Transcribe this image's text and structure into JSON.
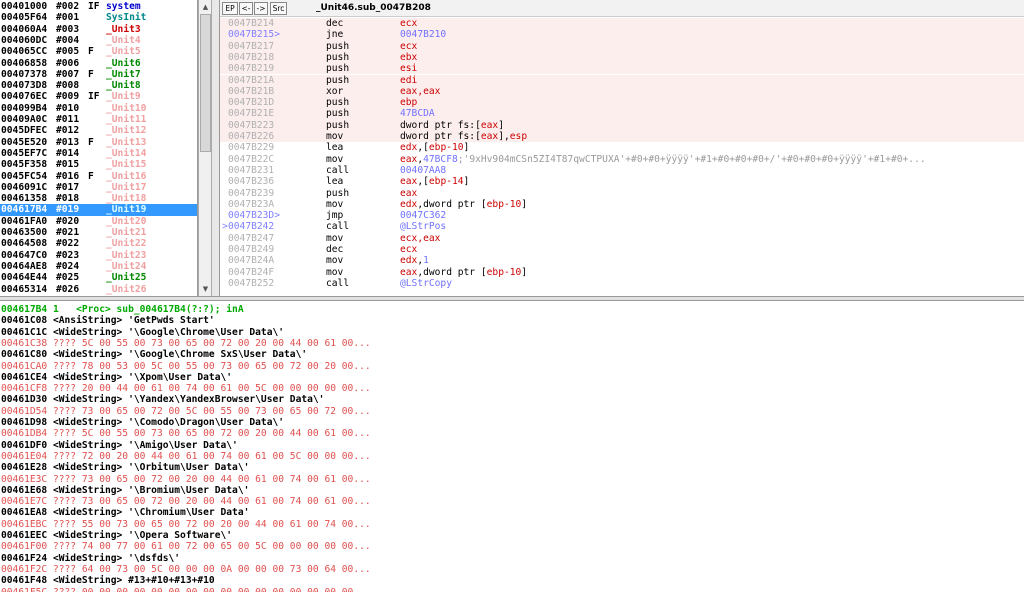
{
  "units": [
    {
      "addr": "00401000",
      "num": "#002",
      "flag": "IF",
      "name": "system",
      "color": "#0000cc"
    },
    {
      "addr": "00405F64",
      "num": "#001",
      "flag": "",
      "name": "SysInit",
      "color": "#008888"
    },
    {
      "addr": "004060A4",
      "num": "#003",
      "flag": "",
      "name": "_Unit3",
      "color": "#cc0000"
    },
    {
      "addr": "004060DC",
      "num": "#004",
      "flag": "",
      "name": "_Unit4",
      "color": "#f0a0a0"
    },
    {
      "addr": "004065CC",
      "num": "#005",
      "flag": "F",
      "name": "_Unit5",
      "color": "#f0a0a0"
    },
    {
      "addr": "00406858",
      "num": "#006",
      "flag": "",
      "name": "_Unit6",
      "color": "#008800"
    },
    {
      "addr": "00407378",
      "num": "#007",
      "flag": "F",
      "name": "_Unit7",
      "color": "#008800"
    },
    {
      "addr": "004073D8",
      "num": "#008",
      "flag": "",
      "name": "_Unit8",
      "color": "#008800"
    },
    {
      "addr": "004076EC",
      "num": "#009",
      "flag": "IF",
      "name": "_Unit9",
      "color": "#f0a0a0"
    },
    {
      "addr": "004099B4",
      "num": "#010",
      "flag": "",
      "name": "_Unit10",
      "color": "#f0a0a0"
    },
    {
      "addr": "00409A0C",
      "num": "#011",
      "flag": "",
      "name": "_Unit11",
      "color": "#f0a0a0"
    },
    {
      "addr": "0045DFEC",
      "num": "#012",
      "flag": "",
      "name": "_Unit12",
      "color": "#f0a0a0"
    },
    {
      "addr": "0045E520",
      "num": "#013",
      "flag": "F",
      "name": "_Unit13",
      "color": "#f0a0a0"
    },
    {
      "addr": "0045EF7C",
      "num": "#014",
      "flag": "",
      "name": "_Unit14",
      "color": "#f0a0a0"
    },
    {
      "addr": "0045F358",
      "num": "#015",
      "flag": "",
      "name": "_Unit15",
      "color": "#f0a0a0"
    },
    {
      "addr": "0045FC54",
      "num": "#016",
      "flag": "F",
      "name": "_Unit16",
      "color": "#f0a0a0"
    },
    {
      "addr": "0046091C",
      "num": "#017",
      "flag": "",
      "name": "_Unit17",
      "color": "#f0a0a0"
    },
    {
      "addr": "00461358",
      "num": "#018",
      "flag": "",
      "name": "_Unit18",
      "color": "#f0a0a0"
    },
    {
      "addr": "004617B4",
      "num": "#019",
      "flag": "",
      "name": "_Unit19",
      "color": "#f0a0a0",
      "selected": true
    },
    {
      "addr": "00461FA0",
      "num": "#020",
      "flag": "",
      "name": "_Unit20",
      "color": "#f0a0a0"
    },
    {
      "addr": "00463500",
      "num": "#021",
      "flag": "",
      "name": "_Unit21",
      "color": "#f0a0a0"
    },
    {
      "addr": "00464508",
      "num": "#022",
      "flag": "",
      "name": "_Unit22",
      "color": "#f0a0a0"
    },
    {
      "addr": "004647C0",
      "num": "#023",
      "flag": "",
      "name": "_Unit23",
      "color": "#f0a0a0"
    },
    {
      "addr": "00464AE8",
      "num": "#024",
      "flag": "",
      "name": "_Unit24",
      "color": "#f0a0a0"
    },
    {
      "addr": "00464E44",
      "num": "#025",
      "flag": "",
      "name": "_Unit25",
      "color": "#008800"
    },
    {
      "addr": "00465314",
      "num": "#026",
      "flag": "",
      "name": "_Unit26",
      "color": "#f0a0a0"
    }
  ],
  "toolbar": {
    "ep_label": "EP",
    "back_label": "<-",
    "fwd_label": "->",
    "src_label": "Src",
    "proc_title": "_Unit46.sub_0047B208"
  },
  "code_lines": [
    {
      "arrow": "",
      "addr": "0047B214",
      "mn": "dec",
      "op": [
        {
          "t": "ecx",
          "c": "red"
        }
      ],
      "shade": true
    },
    {
      "arrow": "",
      "addr": "0047B215>",
      "mn": "jne",
      "op": [
        {
          "t": "0047B210",
          "c": "blu"
        }
      ],
      "shade": true,
      "jt": true
    },
    {
      "arrow": "",
      "addr": "0047B217",
      "mn": "push",
      "op": [
        {
          "t": "ecx",
          "c": "red"
        }
      ],
      "shade": true
    },
    {
      "arrow": "",
      "addr": "0047B218",
      "mn": "push",
      "op": [
        {
          "t": "ebx",
          "c": "red"
        }
      ],
      "shade": true
    },
    {
      "arrow": "",
      "addr": "0047B219",
      "mn": "push",
      "op": [
        {
          "t": "esi",
          "c": "red"
        }
      ],
      "shade": true
    },
    {
      "arrow": "",
      "addr": "0047B21A",
      "mn": "push",
      "op": [
        {
          "t": "edi",
          "c": "red"
        }
      ],
      "shade": true
    },
    {
      "arrow": "",
      "addr": "0047B21B",
      "mn": "xor",
      "op": [
        {
          "t": "eax,eax",
          "c": "red"
        }
      ],
      "shade": true
    },
    {
      "arrow": "",
      "addr": "0047B21D",
      "mn": "push",
      "op": [
        {
          "t": "ebp",
          "c": "red"
        }
      ],
      "shade": true
    },
    {
      "arrow": "",
      "addr": "0047B21E",
      "mn": "push",
      "op": [
        {
          "t": "47BCDA",
          "c": "blu"
        }
      ],
      "shade": true
    },
    {
      "arrow": "",
      "addr": "0047B223",
      "mn": "push",
      "op": [
        {
          "t": "dword ptr fs:[",
          "c": ""
        },
        {
          "t": "eax",
          "c": "red"
        },
        {
          "t": "]",
          "c": ""
        }
      ],
      "shade": true
    },
    {
      "arrow": "",
      "addr": "0047B226",
      "mn": "mov",
      "op": [
        {
          "t": "dword ptr fs:[",
          "c": ""
        },
        {
          "t": "eax",
          "c": "red"
        },
        {
          "t": "],",
          "c": ""
        },
        {
          "t": "esp",
          "c": "red"
        }
      ],
      "shade": true
    },
    {
      "arrow": "",
      "addr": "0047B229",
      "mn": "lea",
      "op": [
        {
          "t": "edx",
          "c": "red"
        },
        {
          "t": ",[",
          "c": ""
        },
        {
          "t": "ebp-10",
          "c": "red"
        },
        {
          "t": "]",
          "c": ""
        }
      ],
      "shade": false
    },
    {
      "arrow": "",
      "addr": "0047B22C",
      "mn": "mov",
      "op": [
        {
          "t": "eax",
          "c": "red"
        },
        {
          "t": ",",
          "c": ""
        },
        {
          "t": "47BCF8",
          "c": "blu"
        },
        {
          "t": ";'9xHv904mCSn5ZI4T87qwCTPUXA'+#0+#0+ÿÿÿÿ'+#1+#0+#0+#0+/'+#0+#0+#0+ÿÿÿÿ'+#1+#0+...",
          "c": "gry"
        }
      ],
      "shade": false
    },
    {
      "arrow": "",
      "addr": "0047B231",
      "mn": "call",
      "op": [
        {
          "t": "00407AA8",
          "c": "blu"
        }
      ],
      "shade": false
    },
    {
      "arrow": "",
      "addr": "0047B236",
      "mn": "lea",
      "op": [
        {
          "t": "eax",
          "c": "red"
        },
        {
          "t": ",[",
          "c": ""
        },
        {
          "t": "ebp-14",
          "c": "red"
        },
        {
          "t": "]",
          "c": ""
        }
      ],
      "shade": false
    },
    {
      "arrow": "",
      "addr": "0047B239",
      "mn": "push",
      "op": [
        {
          "t": "eax",
          "c": "red"
        }
      ],
      "shade": false
    },
    {
      "arrow": "",
      "addr": "0047B23A",
      "mn": "mov",
      "op": [
        {
          "t": "edx",
          "c": "red"
        },
        {
          "t": ",dword ptr [",
          "c": ""
        },
        {
          "t": "ebp-10",
          "c": "red"
        },
        {
          "t": "]",
          "c": ""
        }
      ],
      "shade": false
    },
    {
      "arrow": "",
      "addr": "0047B23D>",
      "mn": "jmp",
      "op": [
        {
          "t": "0047C362",
          "c": "blu"
        }
      ],
      "shade": false,
      "jt": true
    },
    {
      "arrow": ">",
      "addr": "0047B242",
      "mn": "call",
      "op": [
        {
          "t": "@LStrPos",
          "c": "blu"
        }
      ],
      "shade": false,
      "jt": true
    },
    {
      "arrow": "",
      "addr": "0047B247",
      "mn": "mov",
      "op": [
        {
          "t": "ecx,eax",
          "c": "red"
        }
      ],
      "shade": false
    },
    {
      "arrow": "",
      "addr": "0047B249",
      "mn": "dec",
      "op": [
        {
          "t": "ecx",
          "c": "red"
        }
      ],
      "shade": false
    },
    {
      "arrow": "",
      "addr": "0047B24A",
      "mn": "mov",
      "op": [
        {
          "t": "edx",
          "c": "red"
        },
        {
          "t": ",",
          "c": ""
        },
        {
          "t": "1",
          "c": "blu"
        }
      ],
      "shade": false
    },
    {
      "arrow": "",
      "addr": "0047B24F",
      "mn": "mov",
      "op": [
        {
          "t": "eax",
          "c": "red"
        },
        {
          "t": ",dword ptr [",
          "c": ""
        },
        {
          "t": "ebp-10",
          "c": "red"
        },
        {
          "t": "]",
          "c": ""
        }
      ],
      "shade": false
    },
    {
      "arrow": "",
      "addr": "0047B252",
      "mn": "call",
      "op": [
        {
          "t": "@LStrCopy",
          "c": "blu"
        }
      ],
      "shade": false
    }
  ],
  "bottom": [
    {
      "t": "004617B4 1   <Proc> sub_004617B4(?:?); inA",
      "k": "hdr"
    },
    {
      "t": "00461C08 <AnsiString> 'GetPwds Start'",
      "k": "bold"
    },
    {
      "t": "00461C1C <WideString> '\\Google\\Chrome\\User Data\\'",
      "k": "bold"
    },
    {
      "t": "00461C38 ???? 5C 00 55 00 73 00 65 00 72 00 20 00 44 00 61 00...",
      "k": "hex"
    },
    {
      "t": "00461C80 <WideString> '\\Google\\Chrome SxS\\User Data\\'",
      "k": "bold"
    },
    {
      "t": "00461CA0 ???? 78 00 53 00 5C 00 55 00 73 00 65 00 72 00 20 00...",
      "k": "hex"
    },
    {
      "t": "00461CE4 <WideString> '\\Xpom\\User Data\\'",
      "k": "bold"
    },
    {
      "t": "00461CF8 ???? 20 00 44 00 61 00 74 00 61 00 5C 00 00 00 00 00...",
      "k": "hex"
    },
    {
      "t": "00461D30 <WideString> '\\Yandex\\YandexBrowser\\User Data\\'",
      "k": "bold"
    },
    {
      "t": "00461D54 ???? 73 00 65 00 72 00 5C 00 55 00 73 00 65 00 72 00...",
      "k": "hex"
    },
    {
      "t": "00461D98 <WideString> '\\Comodo\\Dragon\\User Data\\'",
      "k": "bold"
    },
    {
      "t": "00461DB4 ???? 5C 00 55 00 73 00 65 00 72 00 20 00 44 00 61 00...",
      "k": "hex"
    },
    {
      "t": "00461DF0 <WideString> '\\Amigo\\User Data\\'",
      "k": "bold"
    },
    {
      "t": "00461E04 ???? 72 00 20 00 44 00 61 00 74 00 61 00 5C 00 00 00...",
      "k": "hex"
    },
    {
      "t": "00461E28 <WideString> '\\Orbitum\\User Data\\'",
      "k": "bold"
    },
    {
      "t": "00461E3C ???? 73 00 65 00 72 00 20 00 44 00 61 00 74 00 61 00...",
      "k": "hex"
    },
    {
      "t": "00461E68 <WideString> '\\Bromium\\User Data\\'",
      "k": "bold"
    },
    {
      "t": "00461E7C ???? 73 00 65 00 72 00 20 00 44 00 61 00 74 00 61 00...",
      "k": "hex"
    },
    {
      "t": "00461EA8 <WideString> '\\Chromium\\User Data'",
      "k": "bold"
    },
    {
      "t": "00461EBC ???? 55 00 73 00 65 00 72 00 20 00 44 00 61 00 74 00...",
      "k": "hex"
    },
    {
      "t": "00461EEC <WideString> '\\Opera Software\\'",
      "k": "bold"
    },
    {
      "t": "00461F00 ???? 74 00 77 00 61 00 72 00 65 00 5C 00 00 00 00 00...",
      "k": "hex"
    },
    {
      "t": "00461F24 <WideString> '\\dsfds\\'",
      "k": "bold"
    },
    {
      "t": "00461F2C ???? 64 00 73 00 5C 00 00 00 0A 00 00 00 73 00 64 00...",
      "k": "hex"
    },
    {
      "t": "00461F48 <WideString> #13+#10+#13+#10",
      "k": "bold"
    },
    {
      "t": "00461F5C ???? 00 00 00 00 00 00 00 00 00 00 00 00 00 00 00 00...",
      "k": "hex"
    }
  ]
}
